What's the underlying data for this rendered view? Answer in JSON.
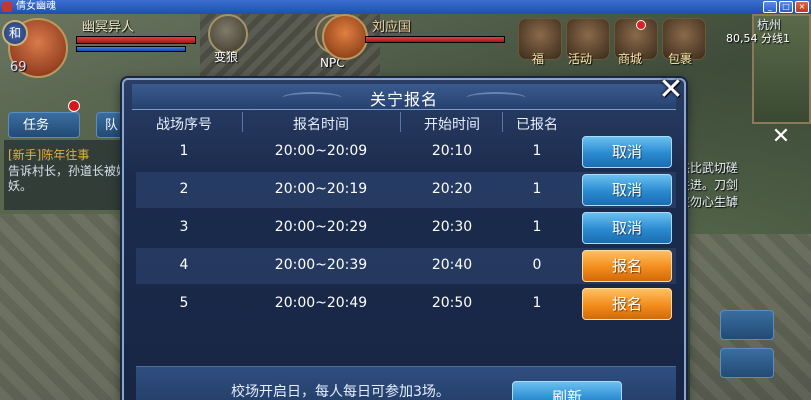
{
  "window": {
    "title": "倩女幽魂"
  },
  "player": {
    "name": "幽冥异人",
    "level": "69",
    "badge": "和"
  },
  "skills": [
    {
      "label": "变狼"
    },
    {
      "label": "NPC"
    }
  ],
  "target": {
    "name": "刘应国"
  },
  "top_menu": [
    {
      "label": "福"
    },
    {
      "label": "活动"
    },
    {
      "label": "商城"
    },
    {
      "label": "包裹"
    }
  ],
  "minimap": {
    "city": "杭州",
    "coords": "80,54 分线1"
  },
  "quest": {
    "tabs": [
      {
        "label": "任务"
      },
      {
        "label": "队"
      }
    ],
    "title": "[新手]陈年往事",
    "text": "告诉村长，孙道长被妖妖。"
  },
  "chat_strip": {
    "lines": [
      "杰比武切磋",
      "共进。刀剑",
      "侠勿心生罅"
    ]
  },
  "dialog": {
    "title": "关宁报名",
    "columns": [
      "战场序号",
      "报名时间",
      "开始时间",
      "已报名"
    ],
    "rows": [
      {
        "index": "1",
        "signup_time": "20:00~20:09",
        "start_time": "20:10",
        "registered": "1",
        "action": "取消",
        "action_color": "#2a8ad0"
      },
      {
        "index": "2",
        "signup_time": "20:00~20:19",
        "start_time": "20:20",
        "registered": "1",
        "action": "取消",
        "action_color": "#2a8ad0"
      },
      {
        "index": "3",
        "signup_time": "20:00~20:29",
        "start_time": "20:30",
        "registered": "1",
        "action": "取消",
        "action_color": "#2a8ad0"
      },
      {
        "index": "4",
        "signup_time": "20:00~20:39",
        "start_time": "20:40",
        "registered": "0",
        "action": "报名",
        "action_color": "#f28c1c"
      },
      {
        "index": "5",
        "signup_time": "20:00~20:49",
        "start_time": "20:50",
        "registered": "1",
        "action": "报名",
        "action_color": "#f28c1c"
      }
    ],
    "footer_text": "校场开启日，每人每日可参加3场。",
    "refresh_label": "刷新"
  }
}
